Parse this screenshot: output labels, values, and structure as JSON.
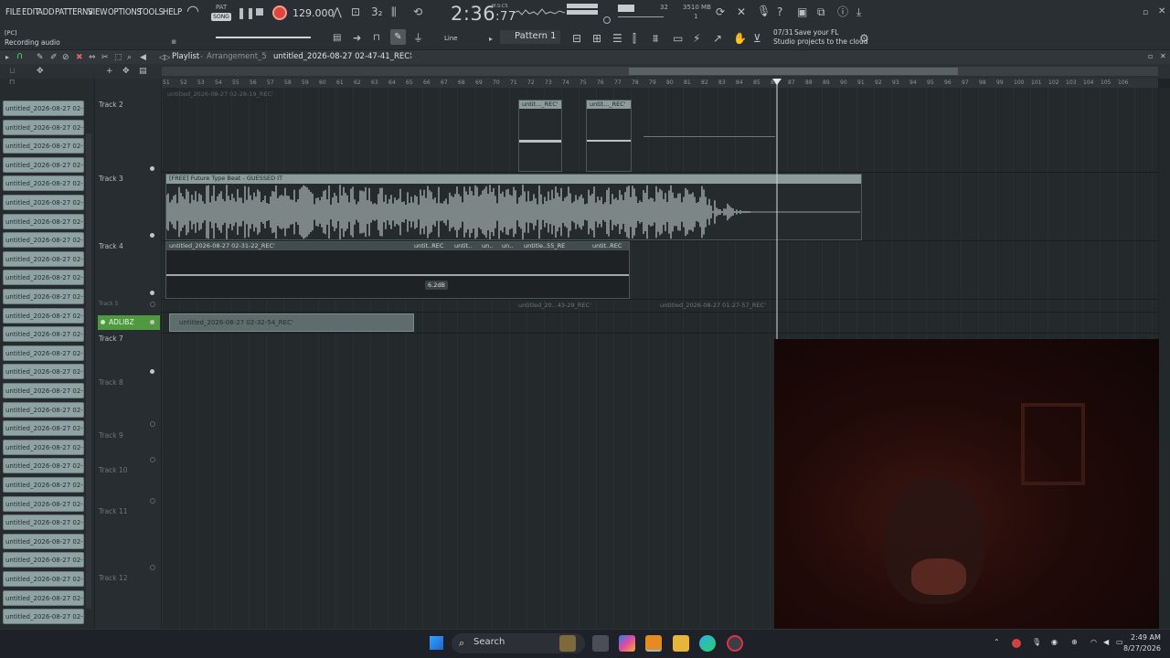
{
  "menu": [
    "FILE",
    "EDIT",
    "ADD",
    "PATTERNS",
    "VIEW",
    "OPTIONS",
    "TOOLS",
    "HELP"
  ],
  "transport": {
    "tempo": "129.000",
    "time": "2:36",
    "time_small": ":77",
    "time_mode": "M:S:CS",
    "pattern_song": "SONG",
    "pat_label": "PAT",
    "memory": "3510 MB",
    "mem_sub1": "32",
    "mem_sub2": "1"
  },
  "hint": {
    "line1": "[PC]",
    "line2": "Recording audio"
  },
  "toolbar2": {
    "snap": "Line",
    "pattern": "Pattern 1",
    "news_count": "07/31",
    "news1": "Save your FL",
    "news2": "Studio projects to the cloud"
  },
  "playlist": {
    "title": "Playlist",
    "sep": "-",
    "arrangement": "Arrangement_5",
    "clipname": "untitled_2026-08-27 02-47-41_REC'"
  },
  "ruler": [
    "51",
    "53",
    "55",
    "57",
    "59",
    "61",
    "63",
    "65",
    "67",
    "69",
    "71",
    "73",
    "75",
    "77",
    "79",
    "81",
    "83",
    "85",
    "87",
    "89",
    "91",
    "93",
    "95",
    "97",
    "99",
    "101",
    "103",
    "105"
  ],
  "ruler_odd": [
    "52",
    "54",
    "56",
    "58",
    "60",
    "62",
    "64",
    "66",
    "68",
    "70",
    "72",
    "74",
    "76",
    "78",
    "80",
    "82",
    "84",
    "86",
    "88",
    "90",
    "92",
    "94",
    "96",
    "98",
    "100",
    "102",
    "104",
    "106"
  ],
  "browser_items": [
    "untitled_2026-08-27 02-...",
    "untitled_2026-08-27 02-...",
    "untitled_2026-08-27 02-...",
    "untitled_2026-08-27 02-...",
    "untitled_2026-08-27 02-...",
    "untitled_2026-08-27 02-...",
    "untitled_2026-08-27 02-...",
    "untitled_2026-08-27 02-...",
    "untitled_2026-08-27 02-...",
    "untitled_2026-08-27 02-...",
    "untitled_2026-08-27 02-...",
    "untitled_2026-08-27 02-...",
    "untitled_2026-08-27 02-...",
    "untitled_2026-08-27 02-...",
    "untitled_2026-08-27 02-...",
    "untitled_2026-08-27 02-...",
    "untitled_2026-08-27 02-...",
    "untitled_2026-08-27 02-...",
    "untitled_2026-08-27 02-...",
    "untitled_2026-08-27 02-...",
    "untitled_2026-08-27 02-...",
    "untitled_2026-08-27 02-...",
    "untitled_2026-08-27 02-...",
    "untitled_2026-08-27 02-...",
    "untitled_2026-08-27 02-...",
    "untitled_2026-08-27 02-...",
    "untitled_2026-08-27 02-...",
    "untitled_2026-08-27 02-..."
  ],
  "tracks": {
    "t2": "Track 2",
    "t3": "Track 3",
    "t4": "Track 4",
    "t5": "Track 5",
    "adlibz": "ADLIBZ",
    "t7": "Track 7",
    "t8": "Track 8",
    "t9": "Track 9",
    "t10": "Track 10",
    "t11": "Track 11",
    "t12": "Track 12"
  },
  "clips": {
    "top_dim": "untitled_2026-08-27 02-28-19_REC'",
    "c1": "untit..._REC'",
    "c2": "untit..._REC'",
    "beat": "[FREE] Future Type Beat - GUESSED IT",
    "t4a": "untitled_2026-08-27 02-31-22_REC'",
    "t4b": "untit..REC",
    "t4c": "untit..",
    "t4d": "un..",
    "t4e": "un..",
    "t4f": "untitle..55_RE",
    "t4g": "untit..REC",
    "gain": "6.2dB",
    "t5a": "untitled_20...43-29_REC'",
    "t5b": "untitled_2026-08-27 01-27-57_REC'",
    "adlib": "untitled_2026-08-27 02-32-54_REC'"
  },
  "taskbar": {
    "search": "Search",
    "time": "2:49 AM",
    "date": "8/27/2026"
  }
}
